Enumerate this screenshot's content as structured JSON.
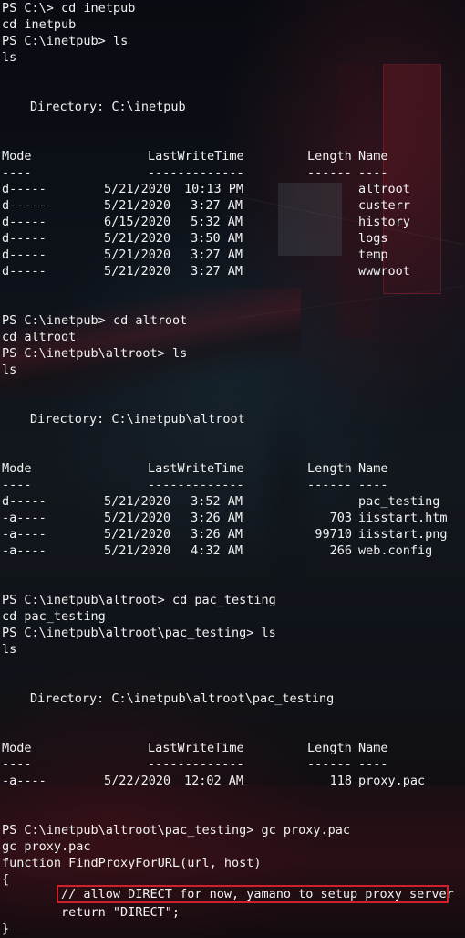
{
  "window": {
    "background_accent": "#b3202f",
    "highlight_color": "#d0202a",
    "text_color": "#f2f2f2"
  },
  "session": [
    {
      "prompt": "PS C:\\>",
      "command": "cd inetpub",
      "echo": "cd inetpub"
    },
    {
      "prompt": "PS C:\\inetpub>",
      "command": "ls",
      "echo": "ls"
    }
  ],
  "listing_headers": {
    "mode": "Mode",
    "lwt": "LastWriteTime",
    "length": "Length",
    "name": "Name",
    "mode_rule": "----",
    "lwt_rule": "-------------",
    "length_rule": "------",
    "name_rule": "----"
  },
  "listings": [
    {
      "directory_label": "Directory: C:\\inetpub",
      "rows": [
        {
          "mode": "d-----",
          "date": "5/21/2020",
          "time": "10:13 PM",
          "length": "",
          "name": "altroot"
        },
        {
          "mode": "d-----",
          "date": "5/21/2020",
          "time": "3:27 AM",
          "length": "",
          "name": "custerr"
        },
        {
          "mode": "d-----",
          "date": "6/15/2020",
          "time": "5:32 AM",
          "length": "",
          "name": "history"
        },
        {
          "mode": "d-----",
          "date": "5/21/2020",
          "time": "3:50 AM",
          "length": "",
          "name": "logs"
        },
        {
          "mode": "d-----",
          "date": "5/21/2020",
          "time": "3:27 AM",
          "length": "",
          "name": "temp"
        },
        {
          "mode": "d-----",
          "date": "5/21/2020",
          "time": "3:27 AM",
          "length": "",
          "name": "wwwroot"
        }
      ]
    },
    {
      "directory_label": "Directory: C:\\inetpub\\altroot",
      "rows": [
        {
          "mode": "d-----",
          "date": "5/21/2020",
          "time": "3:52 AM",
          "length": "",
          "name": "pac_testing"
        },
        {
          "mode": "-a----",
          "date": "5/21/2020",
          "time": "3:26 AM",
          "length": "703",
          "name": "iisstart.htm"
        },
        {
          "mode": "-a----",
          "date": "5/21/2020",
          "time": "3:26 AM",
          "length": "99710",
          "name": "iisstart.png"
        },
        {
          "mode": "-a----",
          "date": "5/21/2020",
          "time": "4:32 AM",
          "length": "266",
          "name": "web.config"
        }
      ]
    },
    {
      "directory_label": "Directory: C:\\inetpub\\altroot\\pac_testing",
      "rows": [
        {
          "mode": "-a----",
          "date": "5/22/2020",
          "time": "12:02 AM",
          "length": "118",
          "name": "proxy.pac"
        }
      ]
    }
  ],
  "commands": [
    {
      "prompt": "PS C:\\>",
      "command": "cd inetpub",
      "echo": "cd inetpub"
    },
    {
      "prompt": "PS C:\\inetpub>",
      "command": "ls",
      "echo": "ls"
    },
    {
      "prompt": "PS C:\\inetpub>",
      "command": "cd altroot",
      "echo": "cd altroot"
    },
    {
      "prompt": "PS C:\\inetpub\\altroot>",
      "command": "ls",
      "echo": "ls"
    },
    {
      "prompt": "PS C:\\inetpub\\altroot>",
      "command": "cd pac_testing",
      "echo": "cd pac_testing"
    },
    {
      "prompt": "PS C:\\inetpub\\altroot\\pac_testing>",
      "command": "ls",
      "echo": "ls"
    },
    {
      "prompt": "PS C:\\inetpub\\altroot\\pac_testing>",
      "command": "gc proxy.pac",
      "echo": "gc proxy.pac"
    }
  ],
  "file_content": [
    "function FindProxyForURL(url, host)",
    "{",
    "        // allow DIRECT for now, yamano to setup proxy server",
    "        return \"DIRECT\";",
    "}"
  ]
}
